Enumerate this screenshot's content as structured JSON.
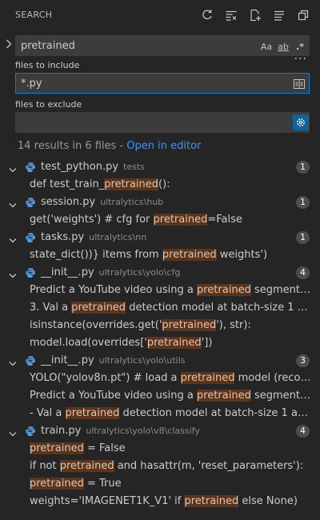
{
  "header": {
    "title": "SEARCH",
    "actions": [
      "refresh-icon",
      "clear-results-icon",
      "new-search-editor-icon",
      "collapse-all-icon",
      "view-as-tree-icon"
    ]
  },
  "search": {
    "value": "pretrained",
    "options": [
      "Aa",
      "ab",
      ".*"
    ]
  },
  "include": {
    "label": "files to include",
    "value": "*.py"
  },
  "exclude": {
    "label": "files to exclude",
    "value": ""
  },
  "summary": {
    "text": "14 results in 6 files - ",
    "link": "Open in editor"
  },
  "accent_color": "#007fd4",
  "highlight_color": "#613214",
  "results": [
    {
      "file": "test_python.py",
      "path": "tests",
      "count": "1",
      "matches": [
        {
          "pre": "def test_train_",
          "hit": "pretrained",
          "post": "():"
        }
      ]
    },
    {
      "file": "session.py",
      "path": "ultralytics\\hub",
      "count": "1",
      "matches": [
        {
          "pre": "get('weights')  # cfg for ",
          "hit": "pretrained",
          "post": "=False"
        }
      ]
    },
    {
      "file": "tasks.py",
      "path": "ultralytics\\nn",
      "count": "1",
      "matches": [
        {
          "pre": "state_dict())} items from ",
          "hit": "pretrained",
          "post": " weights')"
        }
      ]
    },
    {
      "file": "__init__.py",
      "path": "ultralytics\\yolo\\cfg",
      "count": "4",
      "matches": [
        {
          "pre": "Predict a YouTube video using a ",
          "hit": "pretrained",
          "post": " segmentation mo..."
        },
        {
          "pre": "3. Val a ",
          "hit": "pretrained",
          "post": " detection model at batch-size 1 and image..."
        },
        {
          "pre": "isinstance(overrides.get('",
          "hit": "pretrained",
          "post": "'), str):"
        },
        {
          "pre": "model.load(overrides['",
          "hit": "pretrained",
          "post": "'])"
        }
      ]
    },
    {
      "file": "__init__.py",
      "path": "ultralytics\\yolo\\utils",
      "count": "3",
      "matches": [
        {
          "pre": "YOLO(\"yolov8n.pt\")  # load a ",
          "hit": "pretrained",
          "post": " model (recommende..."
        },
        {
          "pre": "Predict a YouTube video using a ",
          "hit": "pretrained",
          "post": " segmentation mo..."
        },
        {
          "pre": "- Val a ",
          "hit": "pretrained",
          "post": " detection model at batch-size 1 and image ..."
        }
      ]
    },
    {
      "file": "train.py",
      "path": "ultralytics\\yolo\\v8\\classify",
      "count": "4",
      "matches": [
        {
          "pre": "",
          "hit": "pretrained",
          "post": " = False"
        },
        {
          "pre": "if not ",
          "hit": "pretrained",
          "post": " and hasattr(m, 'reset_parameters'):"
        },
        {
          "pre": "",
          "hit": "pretrained",
          "post": " = True"
        },
        {
          "pre": "weights='IMAGENET1K_V1' if ",
          "hit": "pretrained",
          "post": " else None)"
        }
      ]
    }
  ]
}
